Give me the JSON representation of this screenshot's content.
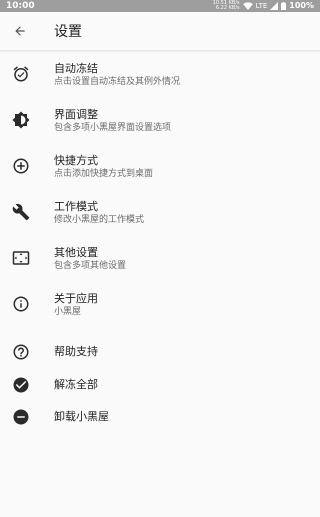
{
  "status_bar": {
    "time": "10:00",
    "speed_up": "10.51 KB/s",
    "speed_down": "6.22 KB/s",
    "network": "LTE",
    "battery": "100%"
  },
  "toolbar": {
    "back_icon": "arrow-left-icon",
    "title": "设置"
  },
  "settings": [
    {
      "icon": "alarm-check-icon",
      "title": "自动冻结",
      "subtitle": "点击设置自动冻结及其例外情况"
    },
    {
      "icon": "brightness-icon",
      "title": "界面调整",
      "subtitle": "包含多项小黑屋界面设置选项"
    },
    {
      "icon": "add-circle-icon",
      "title": "快捷方式",
      "subtitle": "点击添加快捷方式到桌面"
    },
    {
      "icon": "wrench-icon",
      "title": "工作模式",
      "subtitle": "修改小黑屋的工作模式"
    },
    {
      "icon": "settings-overscan-icon",
      "title": "其他设置",
      "subtitle": "包含多项其他设置"
    },
    {
      "icon": "info-icon",
      "title": "关于应用",
      "subtitle": "小黑屋"
    },
    {
      "icon": "help-circle-icon",
      "title": "帮助支持"
    },
    {
      "icon": "check-circle-icon",
      "title": "解冻全部"
    },
    {
      "icon": "remove-circle-icon",
      "title": "卸载小黑屋"
    }
  ]
}
